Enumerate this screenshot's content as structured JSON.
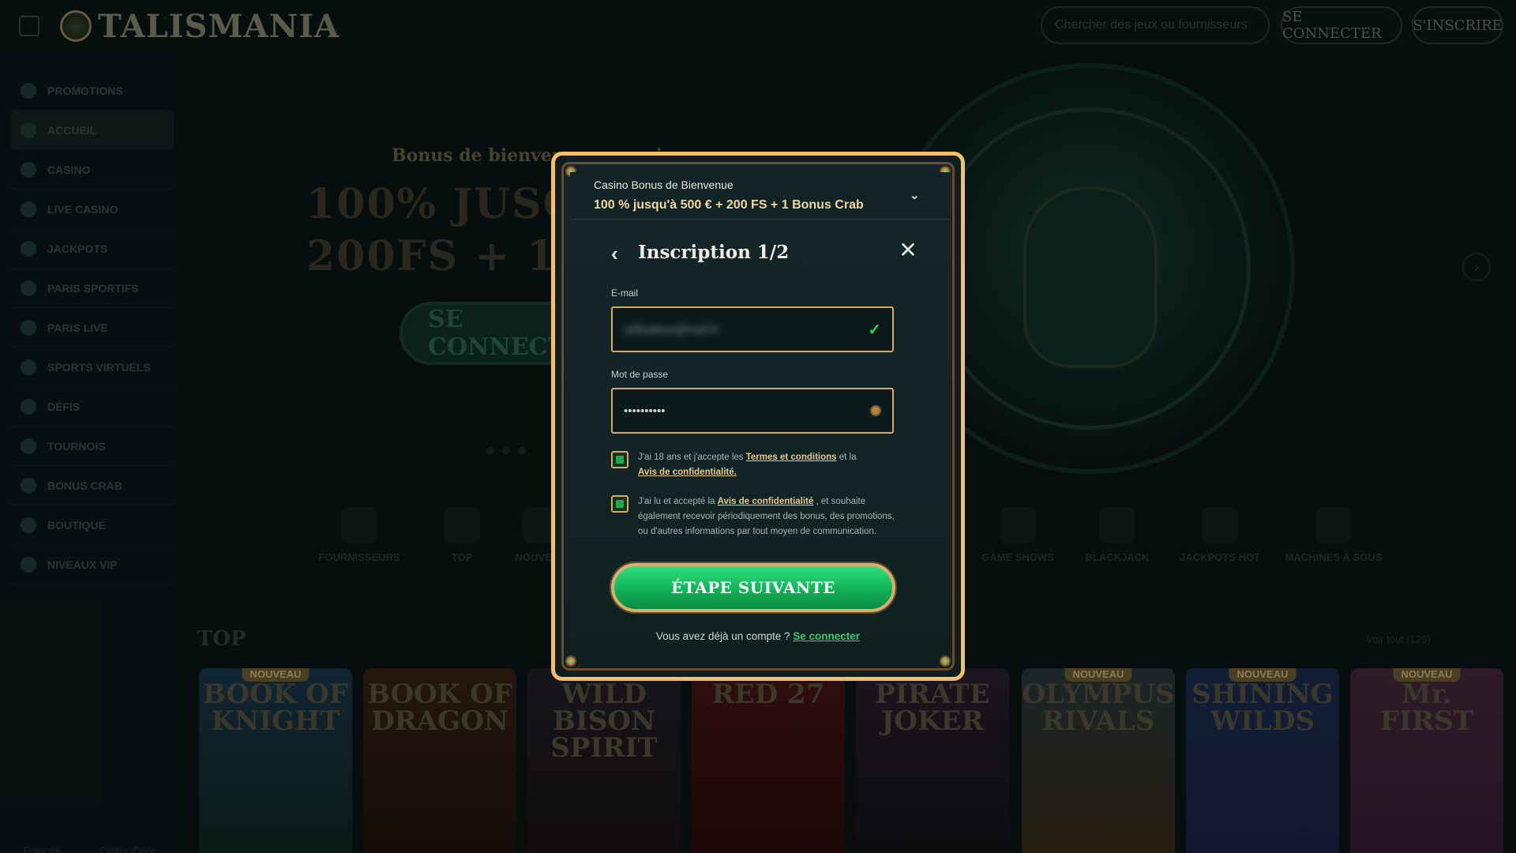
{
  "header": {
    "logo_text": "TALISMANIA",
    "search_placeholder": "Chercher des jeux ou fournisseurs",
    "login_label": "SE CONNECTER",
    "register_label": "S'INSCRIRE"
  },
  "sidebar": {
    "items": [
      {
        "label": "PROMOTIONS"
      },
      {
        "label": "ACCUEIL"
      },
      {
        "label": "CASINO"
      },
      {
        "label": "LIVE CASINO"
      },
      {
        "label": "JACKPOTS"
      },
      {
        "label": "PARIS SPORTIFS"
      },
      {
        "label": "PARIS LIVE"
      },
      {
        "label": "SPORTS VIRTUELS"
      },
      {
        "label": "DÉFIS"
      },
      {
        "label": "TOURNOIS"
      },
      {
        "label": "BONUS CRAB"
      },
      {
        "label": "BOUTIQUE"
      },
      {
        "label": "NIVEAUX VIP"
      }
    ],
    "language": "Français",
    "support": "Centre d'aide"
  },
  "hero": {
    "subtitle": "Bonus de bienvenue au casino",
    "line1": "100% JUSQU'À",
    "line2": "200FS + 1 BONUS",
    "cta": "SE CONNECTER"
  },
  "categories": [
    "FOURNISSEURS",
    "TOP",
    "NOUVEAU",
    "GAME SHOWS",
    "BLACKJACK",
    "JACKPOTS HOT",
    "MACHINES À SOUS"
  ],
  "games": {
    "title": "TOP",
    "see_all": "Voir tout (125)",
    "badge": "NOUVEAU",
    "tiles": [
      "BOOK OF KNIGHT",
      "BOOK OF DRAGON",
      "WILD BISON SPIRIT",
      "RED 27",
      "PIRATE JOKER",
      "OLYMPUS RIVALS",
      "SHINING WILDS",
      "Mr. FIRST"
    ]
  },
  "modal": {
    "bonus_title": "Casino Bonus de Bienvenue",
    "bonus_offer": "100 % jusqu'à 500 € + 200 FS + 1 Bonus Crab",
    "form_title": "Inscription 1/2",
    "email_label": "E-mail",
    "email_value": "utilisateur@mail.fr",
    "password_label": "Mot de passe",
    "password_value": "••••••••••",
    "consent1_a": "J'ai 18 ans et j'accepte les ",
    "consent1_link1": "Termes et conditions",
    "consent1_b": " et la ",
    "consent1_link2": "Avis de confidentialité.",
    "consent2_a": "J'ai lu et accepté la ",
    "consent2_link": "Avis de confidentialité",
    "consent2_b": " , et souhaite également recevoir périodiquement des bonus, des promotions, ou d'autres informations par tout moyen de communication.",
    "next_label": "ÉTAPE SUIVANTE",
    "have_account": "Vous avez déjà un compte ? ",
    "login_link": "Se connecter"
  },
  "colors": {
    "accent_gold": "#f3c067",
    "accent_green": "#12b259",
    "link_green": "#2fcf6a"
  },
  "icons": {
    "back": "chevron-left-icon",
    "close": "close-icon",
    "valid": "check-icon",
    "reveal": "eye-icon",
    "expand": "chevron-down-icon"
  }
}
